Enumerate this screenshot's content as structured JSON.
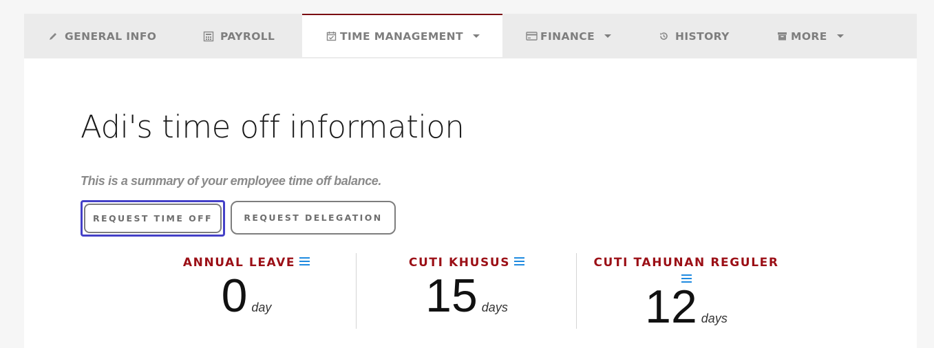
{
  "tabs": [
    {
      "label": "GENERAL INFO",
      "icon": "pencil-icon"
    },
    {
      "label": "PAYROLL",
      "icon": "calculator-icon"
    },
    {
      "label": "TIME MANAGEMENT",
      "icon": "calendar-check-icon",
      "active": true,
      "dropdown": true
    },
    {
      "label": "FINANCE",
      "icon": "credit-card-icon",
      "dropdown": true
    },
    {
      "label": "HISTORY",
      "icon": "history-icon"
    },
    {
      "label": "MORE",
      "icon": "archive-icon",
      "dropdown": true
    }
  ],
  "page": {
    "title": "Adi's time off information",
    "subtitle": "This is a summary of your employee time off balance."
  },
  "actions": {
    "request_time_off": "REQUEST TIME OFF",
    "request_delegation": "REQUEST DELEGATION"
  },
  "balances": [
    {
      "label": "ANNUAL LEAVE",
      "value": "0",
      "unit": "day"
    },
    {
      "label": "CUTI KHUSUS",
      "value": "15",
      "unit": "days"
    },
    {
      "label": "CUTI TAHUNAN REGULER",
      "value": "12",
      "unit": "days"
    }
  ],
  "colors": {
    "accent": "#9b0f16",
    "active_tab_border": "#7a0d12",
    "focus_ring": "#4440c7",
    "menu_icon": "#1e8ae0"
  }
}
